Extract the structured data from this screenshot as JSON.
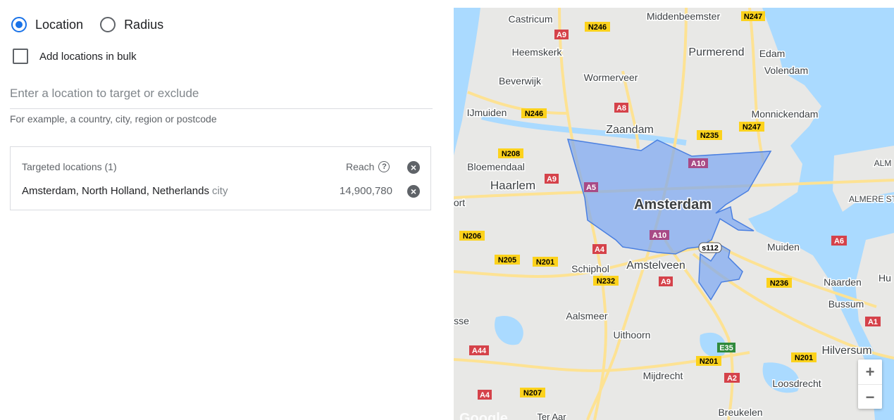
{
  "targeting": {
    "mode_options": [
      {
        "label": "Location",
        "selected": true
      },
      {
        "label": "Radius",
        "selected": false
      }
    ],
    "bulk_label": "Add locations in bulk",
    "input_placeholder": "Enter a location to target or exclude",
    "input_value": "",
    "hint": "For example, a country, city, region or postcode"
  },
  "targeted": {
    "header": "Targeted locations (1)",
    "reach_label": "Reach",
    "help_icon": "help-icon",
    "remove_icon": "close-circle-icon",
    "rows": [
      {
        "name": "Amsterdam, North Holland, Netherlands",
        "type": "city",
        "reach": "14,900,780"
      }
    ]
  },
  "map": {
    "cities": [
      {
        "id": "castricum",
        "label": "Castricum"
      },
      {
        "id": "middenbeemster",
        "label": "Middenbeemster"
      },
      {
        "id": "heemskerk",
        "label": "Heemskerk"
      },
      {
        "id": "purmerend",
        "label": "Purmerend"
      },
      {
        "id": "edam",
        "label": "Edam"
      },
      {
        "id": "volendam",
        "label": "Volendam"
      },
      {
        "id": "beverwijk",
        "label": "Beverwijk"
      },
      {
        "id": "wormerveer",
        "label": "Wormerveer"
      },
      {
        "id": "ijmuiden",
        "label": "IJmuiden"
      },
      {
        "id": "monnickendam",
        "label": "Monnickendam"
      },
      {
        "id": "zaandam",
        "label": "Zaandam"
      },
      {
        "id": "bloemendaal",
        "label": "Bloemendaal"
      },
      {
        "id": "haarlem",
        "label": "Haarlem"
      },
      {
        "id": "amsterdam",
        "label": "Amsterdam"
      },
      {
        "id": "almere",
        "label": "ALMERE ST"
      },
      {
        "id": "alm",
        "label": "ALM"
      },
      {
        "id": "muiden",
        "label": "Muiden"
      },
      {
        "id": "schiphol",
        "label": "Schiphol"
      },
      {
        "id": "amstelveen",
        "label": "Amstelveen"
      },
      {
        "id": "naarden",
        "label": "Naarden"
      },
      {
        "id": "hu",
        "label": "Hu"
      },
      {
        "id": "bussum",
        "label": "Bussum"
      },
      {
        "id": "aalsmeer",
        "label": "Aalsmeer"
      },
      {
        "id": "uithoorn",
        "label": "Uithoorn"
      },
      {
        "id": "hilversum",
        "label": "Hilversum"
      },
      {
        "id": "mijdrecht",
        "label": "Mijdrecht"
      },
      {
        "id": "loosdrecht",
        "label": "Loosdrecht"
      },
      {
        "id": "breukelen",
        "label": "Breukelen"
      },
      {
        "id": "ter-aar",
        "label": "Ter Aar"
      },
      {
        "id": "ort",
        "label": "ort"
      },
      {
        "id": "sse",
        "label": "sse"
      }
    ],
    "road_shields": [
      {
        "id": "n247a",
        "label": "N247",
        "kind": "n"
      },
      {
        "id": "a9a",
        "label": "A9",
        "kind": "a"
      },
      {
        "id": "n246a",
        "label": "N246",
        "kind": "n"
      },
      {
        "id": "a8",
        "label": "A8",
        "kind": "a"
      },
      {
        "id": "n246b",
        "label": "N246",
        "kind": "n"
      },
      {
        "id": "n235",
        "label": "N235",
        "kind": "n"
      },
      {
        "id": "n247b",
        "label": "N247",
        "kind": "n"
      },
      {
        "id": "n208",
        "label": "N208",
        "kind": "n"
      },
      {
        "id": "a10a",
        "label": "A10",
        "kind": "a"
      },
      {
        "id": "a9b",
        "label": "A9",
        "kind": "a"
      },
      {
        "id": "a5",
        "label": "A5",
        "kind": "a"
      },
      {
        "id": "n206",
        "label": "N206",
        "kind": "n"
      },
      {
        "id": "a10b",
        "label": "A10",
        "kind": "a"
      },
      {
        "id": "a4a",
        "label": "A4",
        "kind": "a"
      },
      {
        "id": "s112",
        "label": "s112",
        "kind": "s"
      },
      {
        "id": "a6",
        "label": "A6",
        "kind": "a"
      },
      {
        "id": "n205",
        "label": "N205",
        "kind": "n"
      },
      {
        "id": "n201a",
        "label": "N201",
        "kind": "n"
      },
      {
        "id": "n232",
        "label": "N232",
        "kind": "n"
      },
      {
        "id": "a9c",
        "label": "A9",
        "kind": "a"
      },
      {
        "id": "n236",
        "label": "N236",
        "kind": "n"
      },
      {
        "id": "a1",
        "label": "A1",
        "kind": "a"
      },
      {
        "id": "e35",
        "label": "E35",
        "kind": "e"
      },
      {
        "id": "a44",
        "label": "A44",
        "kind": "a"
      },
      {
        "id": "n201b",
        "label": "N201",
        "kind": "n"
      },
      {
        "id": "n201c",
        "label": "N201",
        "kind": "n"
      },
      {
        "id": "a2",
        "label": "A2",
        "kind": "a"
      },
      {
        "id": "n207",
        "label": "N207",
        "kind": "n"
      },
      {
        "id": "a4b",
        "label": "A4",
        "kind": "a"
      }
    ],
    "attribution": "Google",
    "zoom_in_label": "+",
    "zoom_out_label": "−",
    "colors": {
      "water": "#aadaff",
      "land": "#e8e8e6",
      "road": "#fde293",
      "target_fill": "#7ba7f2",
      "target_stroke": "#4a7fe0"
    }
  }
}
